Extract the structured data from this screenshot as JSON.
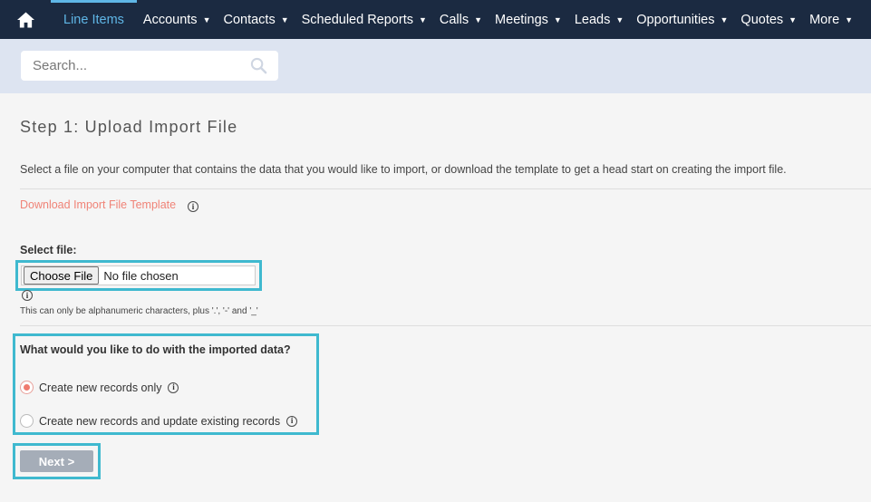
{
  "nav": {
    "items": [
      {
        "label": "Line Items",
        "active": true
      },
      {
        "label": "Accounts"
      },
      {
        "label": "Contacts"
      },
      {
        "label": "Scheduled Reports"
      },
      {
        "label": "Calls"
      },
      {
        "label": "Meetings"
      },
      {
        "label": "Leads"
      },
      {
        "label": "Opportunities"
      },
      {
        "label": "Quotes"
      },
      {
        "label": "More"
      }
    ],
    "caret": "▼",
    "home_icon": "home-icon"
  },
  "search": {
    "placeholder": "Search...",
    "icon": "search-icon"
  },
  "step": {
    "title": "Step 1: Upload Import File",
    "description": "Select a file on your computer that contains the data that you would like to import, or download the template to get a head start on creating the import file.",
    "download_link": "Download Import File Template",
    "info_glyph": "i"
  },
  "file": {
    "label": "Select file:",
    "button": "Choose File",
    "status": "No file chosen",
    "hint": "This can only be alphanumeric characters, plus '.', '-' and '_'"
  },
  "import_options": {
    "question": "What would you like to do with the imported data?",
    "options": [
      {
        "label": "Create new records only",
        "selected": true
      },
      {
        "label": "Create new records and update existing records",
        "selected": false
      }
    ]
  },
  "actions": {
    "next": "Next >"
  },
  "colors": {
    "nav_bg": "#1b2a41",
    "nav_active": "#5fb6e6",
    "highlight_border": "#3fb9cf",
    "link": "#f08377",
    "radio_selected": "#ef7b6f",
    "next_button": "#a5adb8"
  }
}
